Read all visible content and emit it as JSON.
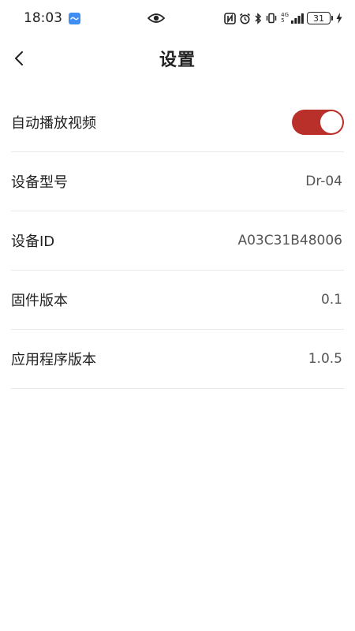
{
  "status_bar": {
    "time": "18:03",
    "network": "4G",
    "network_sub": "5",
    "battery": "31",
    "icons": [
      "message-icon",
      "eye-icon",
      "nfc-icon",
      "alarm-icon",
      "bluetooth-icon",
      "vibrate-icon",
      "signal-icon",
      "battery-icon",
      "charging-icon"
    ]
  },
  "header": {
    "title": "设置",
    "back_icon": "chevron-left-icon"
  },
  "settings": {
    "autoplay": {
      "label": "自动播放视频",
      "enabled": true
    },
    "device_model": {
      "label": "设备型号",
      "value": "Dr-04"
    },
    "device_id": {
      "label": "设备ID",
      "value": "A03C31B48006"
    },
    "firmware_version": {
      "label": "固件版本",
      "value": "0.1"
    },
    "app_version": {
      "label": "应用程序版本",
      "value": "1.0.5"
    }
  },
  "colors": {
    "toggle_on": "#b92f2a",
    "divider": "#e8e8e8",
    "text": "#222222"
  }
}
